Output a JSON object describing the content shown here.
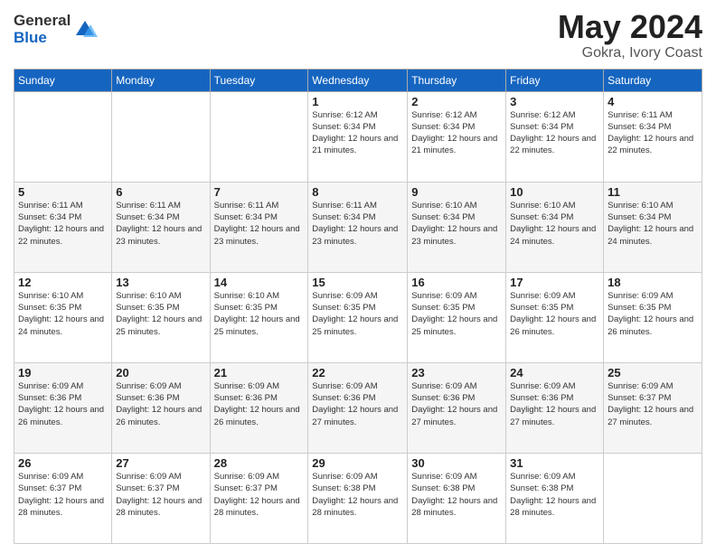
{
  "logo": {
    "general": "General",
    "blue": "Blue"
  },
  "title": {
    "month_year": "May 2024",
    "location": "Gokra, Ivory Coast"
  },
  "days_of_week": [
    "Sunday",
    "Monday",
    "Tuesday",
    "Wednesday",
    "Thursday",
    "Friday",
    "Saturday"
  ],
  "weeks": [
    [
      {
        "day": "",
        "info": ""
      },
      {
        "day": "",
        "info": ""
      },
      {
        "day": "",
        "info": ""
      },
      {
        "day": "1",
        "info": "Sunrise: 6:12 AM\nSunset: 6:34 PM\nDaylight: 12 hours\nand 21 minutes."
      },
      {
        "day": "2",
        "info": "Sunrise: 6:12 AM\nSunset: 6:34 PM\nDaylight: 12 hours\nand 21 minutes."
      },
      {
        "day": "3",
        "info": "Sunrise: 6:12 AM\nSunset: 6:34 PM\nDaylight: 12 hours\nand 22 minutes."
      },
      {
        "day": "4",
        "info": "Sunrise: 6:11 AM\nSunset: 6:34 PM\nDaylight: 12 hours\nand 22 minutes."
      }
    ],
    [
      {
        "day": "5",
        "info": "Sunrise: 6:11 AM\nSunset: 6:34 PM\nDaylight: 12 hours\nand 22 minutes."
      },
      {
        "day": "6",
        "info": "Sunrise: 6:11 AM\nSunset: 6:34 PM\nDaylight: 12 hours\nand 23 minutes."
      },
      {
        "day": "7",
        "info": "Sunrise: 6:11 AM\nSunset: 6:34 PM\nDaylight: 12 hours\nand 23 minutes."
      },
      {
        "day": "8",
        "info": "Sunrise: 6:11 AM\nSunset: 6:34 PM\nDaylight: 12 hours\nand 23 minutes."
      },
      {
        "day": "9",
        "info": "Sunrise: 6:10 AM\nSunset: 6:34 PM\nDaylight: 12 hours\nand 23 minutes."
      },
      {
        "day": "10",
        "info": "Sunrise: 6:10 AM\nSunset: 6:34 PM\nDaylight: 12 hours\nand 24 minutes."
      },
      {
        "day": "11",
        "info": "Sunrise: 6:10 AM\nSunset: 6:34 PM\nDaylight: 12 hours\nand 24 minutes."
      }
    ],
    [
      {
        "day": "12",
        "info": "Sunrise: 6:10 AM\nSunset: 6:35 PM\nDaylight: 12 hours\nand 24 minutes."
      },
      {
        "day": "13",
        "info": "Sunrise: 6:10 AM\nSunset: 6:35 PM\nDaylight: 12 hours\nand 25 minutes."
      },
      {
        "day": "14",
        "info": "Sunrise: 6:10 AM\nSunset: 6:35 PM\nDaylight: 12 hours\nand 25 minutes."
      },
      {
        "day": "15",
        "info": "Sunrise: 6:09 AM\nSunset: 6:35 PM\nDaylight: 12 hours\nand 25 minutes."
      },
      {
        "day": "16",
        "info": "Sunrise: 6:09 AM\nSunset: 6:35 PM\nDaylight: 12 hours\nand 25 minutes."
      },
      {
        "day": "17",
        "info": "Sunrise: 6:09 AM\nSunset: 6:35 PM\nDaylight: 12 hours\nand 26 minutes."
      },
      {
        "day": "18",
        "info": "Sunrise: 6:09 AM\nSunset: 6:35 PM\nDaylight: 12 hours\nand 26 minutes."
      }
    ],
    [
      {
        "day": "19",
        "info": "Sunrise: 6:09 AM\nSunset: 6:36 PM\nDaylight: 12 hours\nand 26 minutes."
      },
      {
        "day": "20",
        "info": "Sunrise: 6:09 AM\nSunset: 6:36 PM\nDaylight: 12 hours\nand 26 minutes."
      },
      {
        "day": "21",
        "info": "Sunrise: 6:09 AM\nSunset: 6:36 PM\nDaylight: 12 hours\nand 26 minutes."
      },
      {
        "day": "22",
        "info": "Sunrise: 6:09 AM\nSunset: 6:36 PM\nDaylight: 12 hours\nand 27 minutes."
      },
      {
        "day": "23",
        "info": "Sunrise: 6:09 AM\nSunset: 6:36 PM\nDaylight: 12 hours\nand 27 minutes."
      },
      {
        "day": "24",
        "info": "Sunrise: 6:09 AM\nSunset: 6:36 PM\nDaylight: 12 hours\nand 27 minutes."
      },
      {
        "day": "25",
        "info": "Sunrise: 6:09 AM\nSunset: 6:37 PM\nDaylight: 12 hours\nand 27 minutes."
      }
    ],
    [
      {
        "day": "26",
        "info": "Sunrise: 6:09 AM\nSunset: 6:37 PM\nDaylight: 12 hours\nand 28 minutes."
      },
      {
        "day": "27",
        "info": "Sunrise: 6:09 AM\nSunset: 6:37 PM\nDaylight: 12 hours\nand 28 minutes."
      },
      {
        "day": "28",
        "info": "Sunrise: 6:09 AM\nSunset: 6:37 PM\nDaylight: 12 hours\nand 28 minutes."
      },
      {
        "day": "29",
        "info": "Sunrise: 6:09 AM\nSunset: 6:38 PM\nDaylight: 12 hours\nand 28 minutes."
      },
      {
        "day": "30",
        "info": "Sunrise: 6:09 AM\nSunset: 6:38 PM\nDaylight: 12 hours\nand 28 minutes."
      },
      {
        "day": "31",
        "info": "Sunrise: 6:09 AM\nSunset: 6:38 PM\nDaylight: 12 hours\nand 28 minutes."
      },
      {
        "day": "",
        "info": ""
      }
    ]
  ]
}
